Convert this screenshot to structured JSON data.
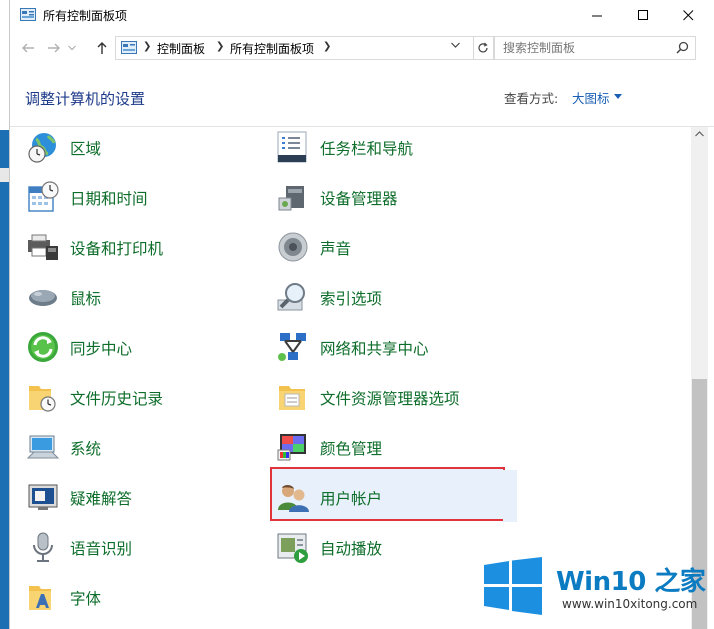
{
  "window": {
    "title": "所有控制面板项"
  },
  "address": {
    "crumbs": [
      "控制面板",
      "所有控制面板项"
    ],
    "search_placeholder": "搜索控制面板"
  },
  "header": {
    "title": "调整计算机的设置",
    "view_by_label": "查看方式:",
    "view_by_value": "大图标"
  },
  "items": [
    {
      "label": "区域",
      "icon": "globe-clock-icon"
    },
    {
      "label": "任务栏和导航",
      "icon": "taskbar-icon"
    },
    {
      "label": "日期和时间",
      "icon": "calendar-clock-icon"
    },
    {
      "label": "设备管理器",
      "icon": "device-manager-icon"
    },
    {
      "label": "设备和打印机",
      "icon": "printer-icon"
    },
    {
      "label": "声音",
      "icon": "speaker-icon"
    },
    {
      "label": "鼠标",
      "icon": "mouse-icon"
    },
    {
      "label": "索引选项",
      "icon": "magnifier-icon"
    },
    {
      "label": "同步中心",
      "icon": "sync-icon"
    },
    {
      "label": "网络和共享中心",
      "icon": "network-icon"
    },
    {
      "label": "文件历史记录",
      "icon": "file-history-icon"
    },
    {
      "label": "文件资源管理器选项",
      "icon": "folder-options-icon"
    },
    {
      "label": "系统",
      "icon": "computer-icon"
    },
    {
      "label": "颜色管理",
      "icon": "color-management-icon"
    },
    {
      "label": "疑难解答",
      "icon": "troubleshoot-icon"
    },
    {
      "label": "用户帐户",
      "icon": "users-icon"
    },
    {
      "label": "语音识别",
      "icon": "microphone-icon"
    },
    {
      "label": "自动播放",
      "icon": "autoplay-icon"
    },
    {
      "label": "字体",
      "icon": "font-folder-icon"
    }
  ],
  "watermark": {
    "title": "Win10 之家",
    "url": "www.win10xitong.com"
  },
  "colors": {
    "link_green": "#0d6d2a",
    "title_blue": "#1e3b8a",
    "highlight_red": "#e0343a"
  }
}
